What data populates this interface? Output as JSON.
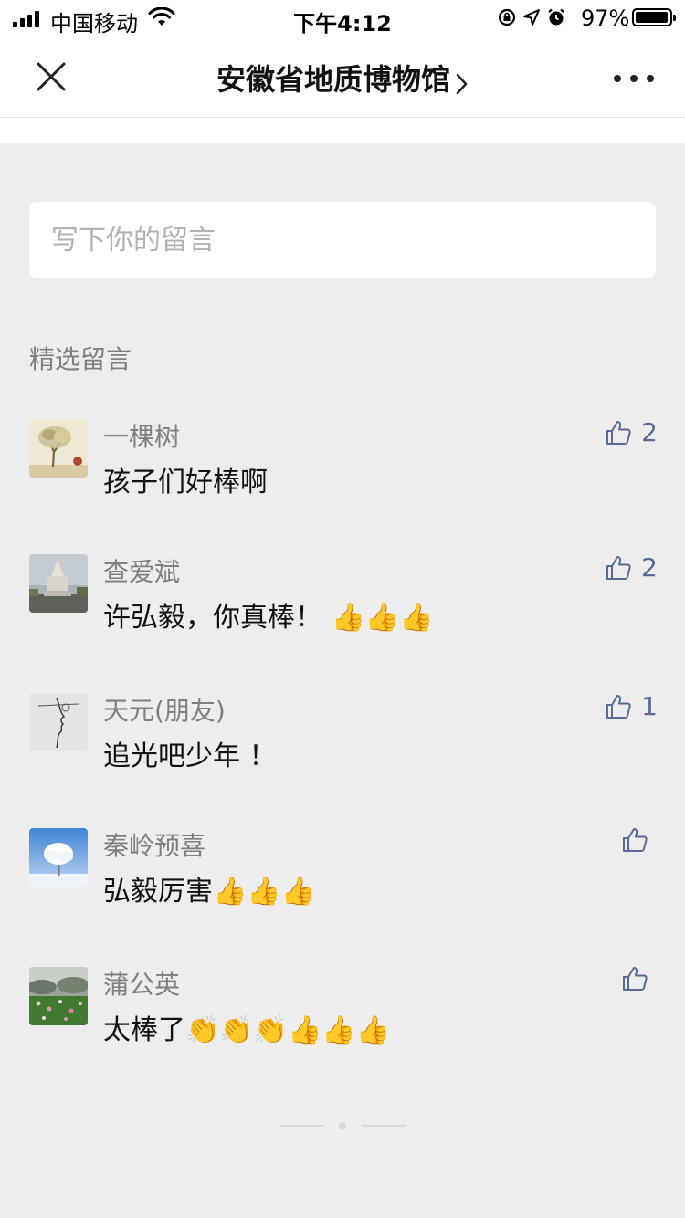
{
  "status_bar": {
    "carrier": "中国移动",
    "time": "下午4:12",
    "battery": "97%",
    "battery_level": 0.97
  },
  "nav": {
    "title": "安徽省地质博物馆"
  },
  "comment_box": {
    "placeholder": "写下你的留言"
  },
  "section_title": "精选留言",
  "comments": [
    {
      "nickname": "一棵树",
      "content": "孩子们好棒啊",
      "likes": "2"
    },
    {
      "nickname": "查爱斌",
      "content": "许弘毅，你真棒！ 👍👍👍",
      "likes": "2"
    },
    {
      "nickname": "天元(朋友)",
      "content": "追光吧少年 ！",
      "likes": "1"
    },
    {
      "nickname": "秦岭预喜",
      "content": "弘毅厉害👍👍👍",
      "likes": ""
    },
    {
      "nickname": "蒲公英",
      "content": "太棒了👏👏👏👍👍👍",
      "likes": ""
    }
  ],
  "colors": {
    "link_blue": "#576B95",
    "background": "#EDEDED",
    "secondary_text": "#7F7F7F"
  }
}
